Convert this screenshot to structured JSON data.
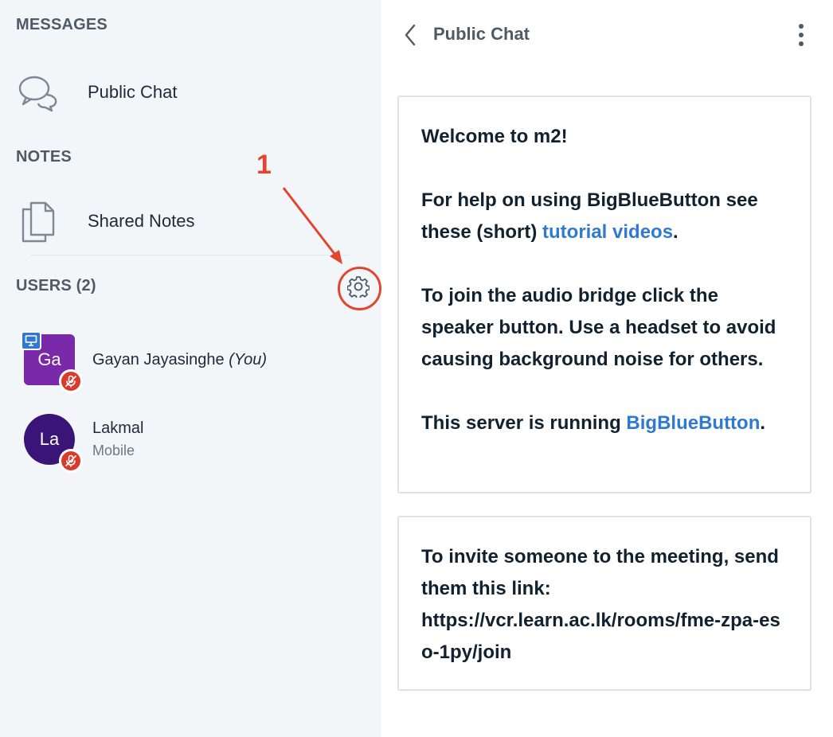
{
  "sidebar": {
    "messages_title": "MESSAGES",
    "public_chat_label": "Public Chat",
    "notes_title": "NOTES",
    "shared_notes_label": "Shared Notes",
    "users_title": "USERS (2)",
    "users": [
      {
        "initials": "Ga",
        "name": "Gayan Jayasinghe",
        "you_label": "(You)",
        "avatar_color": "#7a2aa8",
        "presenter": true,
        "muted": true
      },
      {
        "initials": "La",
        "name": "Lakmal",
        "sub": "Mobile",
        "avatar_color": "#3a1477",
        "presenter": false,
        "muted": true
      }
    ]
  },
  "annotation": {
    "number": "1",
    "color": "#e24630"
  },
  "chat": {
    "title": "Public Chat",
    "welcome": {
      "line1_prefix": "Welcome to ",
      "line1_meeting": "m2",
      "line1_suffix": "!",
      "help_prefix": "For help on using BigBlueButton see these (short) ",
      "help_link": "tutorial videos",
      "help_suffix": ".",
      "audio_text": "To join the audio bridge click the speaker button. Use a headset to avoid causing background noise for others.",
      "server_prefix": "This server is running ",
      "server_link": "BigBlueButton",
      "server_suffix": "."
    },
    "invite": {
      "text": "To invite someone to the meeting, send them this link:",
      "link": "https://vcr.learn.ac.lk/rooms/fme-zpa-eso-1py/join"
    }
  },
  "colors": {
    "link": "#2f7ad0",
    "sidebar_bg": "#f3f6f9",
    "mute": "#d93a2a",
    "presenter": "#2f7ad0"
  }
}
